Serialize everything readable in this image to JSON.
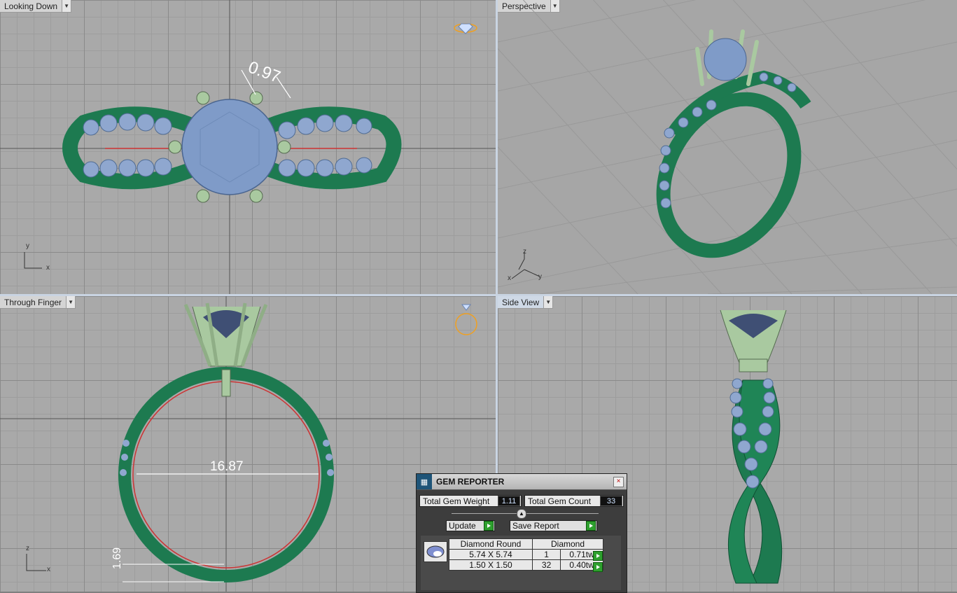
{
  "viewports": {
    "top_left": {
      "label": "Looking Down",
      "dimension": "0.97",
      "axis_v": "y",
      "axis_h": "x"
    },
    "top_right": {
      "label": "Perspective",
      "axis_v": "z",
      "axis_h": "y",
      "axis_d": "x"
    },
    "bottom_left": {
      "label": "Through Finger",
      "dimension_inner": "16.87",
      "dimension_bottom": "1.69",
      "axis_v": "z",
      "axis_h": "x"
    },
    "bottom_right": {
      "label": "Side View"
    }
  },
  "gem_reporter": {
    "title": "GEM REPORTER",
    "close": "×",
    "weight_label": "Total Gem Weight",
    "weight_value": "1.11",
    "count_label": "Total Gem Count",
    "count_value": "33",
    "update_label": "Update",
    "save_label": "Save Report",
    "table": {
      "header_shape": "Diamond Round",
      "header_material": "Diamond",
      "rows": [
        {
          "size": "5.74 X 5.74",
          "count": "1",
          "weight": "0.71tw"
        },
        {
          "size": "1.50 X 1.50",
          "count": "32",
          "weight": "0.40tw"
        }
      ]
    }
  },
  "colors": {
    "metal": "#1d7a50",
    "prong": "#a9c9a0",
    "gem": "#7f9bc8",
    "accent": "#f0a020"
  }
}
